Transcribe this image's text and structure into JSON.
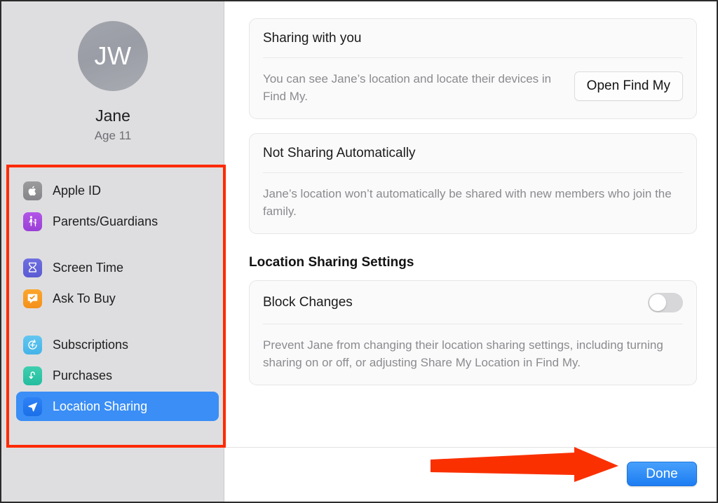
{
  "sidebar": {
    "profile": {
      "avatar_initials": "JW",
      "name": "Jane",
      "age": "Age 11"
    },
    "items": [
      {
        "label": "Apple ID",
        "icon": "apple-logo-icon",
        "selected": false
      },
      {
        "label": "Parents/Guardians",
        "icon": "family-figures-icon",
        "selected": false
      },
      {
        "label": "Screen Time",
        "icon": "hourglass-icon",
        "selected": false
      },
      {
        "label": "Ask To Buy",
        "icon": "checkmark-bubble-icon",
        "selected": false
      },
      {
        "label": "Subscriptions",
        "icon": "plus-refresh-icon",
        "selected": false
      },
      {
        "label": "Purchases",
        "icon": "purchase-arrow-icon",
        "selected": false
      },
      {
        "label": "Location Sharing",
        "icon": "navigation-arrow-icon",
        "selected": true
      }
    ]
  },
  "main": {
    "cards": [
      {
        "title": "Sharing with you",
        "description": "You can see Jane’s location and locate their devices in Find My.",
        "button_label": "Open Find My"
      },
      {
        "title": "Not Sharing Automatically",
        "description": "Jane’s location won’t automatically be shared with new members who join the family."
      }
    ],
    "section_heading": "Location Sharing Settings",
    "setting": {
      "label": "Block Changes",
      "toggle_state": "off",
      "description": "Prevent Jane from changing their location sharing settings, including turning sharing on or off, or adjusting Share My Location in Find My."
    }
  },
  "footer": {
    "done_label": "Done"
  },
  "annotations": {
    "highlight_color": "#ff2a00",
    "arrow_color": "#fa3000",
    "accent_color": "#3a8ef6"
  }
}
